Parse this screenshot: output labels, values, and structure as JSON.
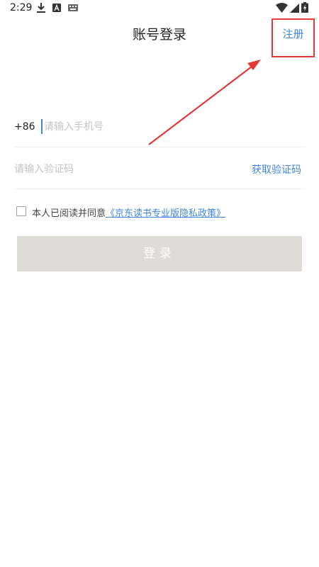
{
  "status_bar": {
    "time": "2:29",
    "icons": [
      "download-icon",
      "a-icon",
      "keyboard-icon",
      "wifi-icon",
      "signal-icon",
      "battery-icon"
    ]
  },
  "header": {
    "title": "账号登录",
    "register_label": "注册"
  },
  "phone": {
    "country_code": "+86",
    "placeholder": "请输入手机号",
    "value": ""
  },
  "code": {
    "placeholder": "请输入验证码",
    "value": "",
    "get_code_label": "获取验证码"
  },
  "agreement": {
    "checked": false,
    "text": "本人已阅读并同意",
    "policy_link": "《京东读书专业版隐私政策》"
  },
  "login_button": {
    "label": "登录"
  },
  "colors": {
    "accent": "#3f86d8",
    "annotation_red": "#e53935",
    "button_disabled": "#dfdcd8"
  }
}
